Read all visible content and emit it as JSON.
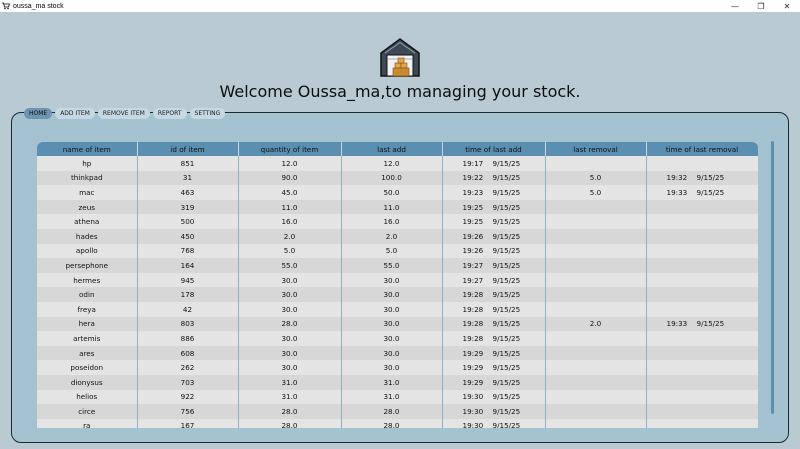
{
  "window": {
    "title": "oussa_ma stock",
    "minimize": "—",
    "restore": "❐",
    "close": "✕"
  },
  "welcome": "Welcome Oussa_ma,to managing your stock.",
  "nav": {
    "home": "HOME",
    "add": "ADD ITEM",
    "remove": "REMOVE ITEM",
    "report": "REPORT",
    "setting": "SETTING"
  },
  "columns": [
    "name of item",
    "id of item",
    "quantity of item",
    "last add",
    "time of last add",
    "last removal",
    "time of last removal"
  ],
  "rows": [
    {
      "name": "hp",
      "id": "851",
      "qty": "12.0",
      "last_add": "12.0",
      "add_time": "19:17",
      "add_date": "9/15/25",
      "last_rem": "",
      "rem_time": "",
      "rem_date": ""
    },
    {
      "name": "thinkpad",
      "id": "31",
      "qty": "90.0",
      "last_add": "100.0",
      "add_time": "19:22",
      "add_date": "9/15/25",
      "last_rem": "5.0",
      "rem_time": "19:32",
      "rem_date": "9/15/25"
    },
    {
      "name": "mac",
      "id": "463",
      "qty": "45.0",
      "last_add": "50.0",
      "add_time": "19:23",
      "add_date": "9/15/25",
      "last_rem": "5.0",
      "rem_time": "19:33",
      "rem_date": "9/15/25"
    },
    {
      "name": "zeus",
      "id": "319",
      "qty": "11.0",
      "last_add": "11.0",
      "add_time": "19:25",
      "add_date": "9/15/25",
      "last_rem": "",
      "rem_time": "",
      "rem_date": ""
    },
    {
      "name": "athena",
      "id": "500",
      "qty": "16.0",
      "last_add": "16.0",
      "add_time": "19:25",
      "add_date": "9/15/25",
      "last_rem": "",
      "rem_time": "",
      "rem_date": ""
    },
    {
      "name": "hades",
      "id": "450",
      "qty": "2.0",
      "last_add": "2.0",
      "add_time": "19:26",
      "add_date": "9/15/25",
      "last_rem": "",
      "rem_time": "",
      "rem_date": ""
    },
    {
      "name": "apollo",
      "id": "768",
      "qty": "5.0",
      "last_add": "5.0",
      "add_time": "19:26",
      "add_date": "9/15/25",
      "last_rem": "",
      "rem_time": "",
      "rem_date": ""
    },
    {
      "name": "persephone",
      "id": "164",
      "qty": "55.0",
      "last_add": "55.0",
      "add_time": "19:27",
      "add_date": "9/15/25",
      "last_rem": "",
      "rem_time": "",
      "rem_date": ""
    },
    {
      "name": "hermes",
      "id": "945",
      "qty": "30.0",
      "last_add": "30.0",
      "add_time": "19:27",
      "add_date": "9/15/25",
      "last_rem": "",
      "rem_time": "",
      "rem_date": ""
    },
    {
      "name": "odin",
      "id": "178",
      "qty": "30.0",
      "last_add": "30.0",
      "add_time": "19:28",
      "add_date": "9/15/25",
      "last_rem": "",
      "rem_time": "",
      "rem_date": ""
    },
    {
      "name": "freya",
      "id": "42",
      "qty": "30.0",
      "last_add": "30.0",
      "add_time": "19:28",
      "add_date": "9/15/25",
      "last_rem": "",
      "rem_time": "",
      "rem_date": ""
    },
    {
      "name": "hera",
      "id": "803",
      "qty": "28.0",
      "last_add": "30.0",
      "add_time": "19:28",
      "add_date": "9/15/25",
      "last_rem": "2.0",
      "rem_time": "19:33",
      "rem_date": "9/15/25"
    },
    {
      "name": "artemis",
      "id": "886",
      "qty": "30.0",
      "last_add": "30.0",
      "add_time": "19:28",
      "add_date": "9/15/25",
      "last_rem": "",
      "rem_time": "",
      "rem_date": ""
    },
    {
      "name": "ares",
      "id": "608",
      "qty": "30.0",
      "last_add": "30.0",
      "add_time": "19:29",
      "add_date": "9/15/25",
      "last_rem": "",
      "rem_time": "",
      "rem_date": ""
    },
    {
      "name": "poseidon",
      "id": "262",
      "qty": "30.0",
      "last_add": "30.0",
      "add_time": "19:29",
      "add_date": "9/15/25",
      "last_rem": "",
      "rem_time": "",
      "rem_date": ""
    },
    {
      "name": "dionysus",
      "id": "703",
      "qty": "31.0",
      "last_add": "31.0",
      "add_time": "19:29",
      "add_date": "9/15/25",
      "last_rem": "",
      "rem_time": "",
      "rem_date": ""
    },
    {
      "name": "helios",
      "id": "922",
      "qty": "31.0",
      "last_add": "31.0",
      "add_time": "19:30",
      "add_date": "9/15/25",
      "last_rem": "",
      "rem_time": "",
      "rem_date": ""
    },
    {
      "name": "circe",
      "id": "756",
      "qty": "28.0",
      "last_add": "28.0",
      "add_time": "19:30",
      "add_date": "9/15/25",
      "last_rem": "",
      "rem_time": "",
      "rem_date": ""
    },
    {
      "name": "ra",
      "id": "167",
      "qty": "28.0",
      "last_add": "28.0",
      "add_time": "19:30",
      "add_date": "9/15/25",
      "last_rem": "",
      "rem_time": "",
      "rem_date": ""
    }
  ]
}
